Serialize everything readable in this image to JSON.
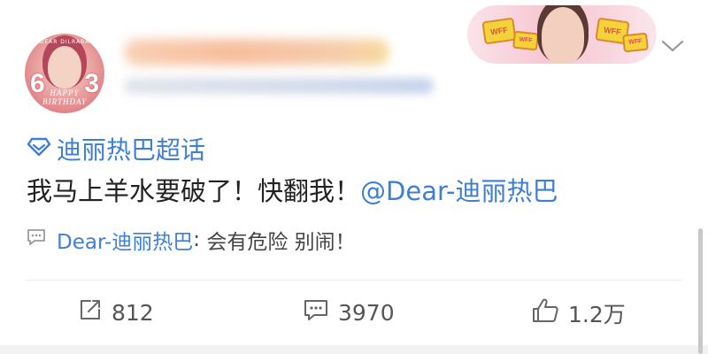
{
  "post": {
    "avatar": {
      "numbers": [
        "6",
        "3"
      ],
      "caption": "HAPPY BIRTHDAY",
      "top_text": "DEAR DILRABA"
    },
    "badge": {
      "sign_text": "WFF"
    },
    "topic": {
      "label": "迪丽热巴超话",
      "icon": "diamond-icon"
    },
    "body": {
      "text": "我马上羊水要破了！快翻我！",
      "mention": "@Dear-迪丽热巴"
    },
    "comment_preview": {
      "user": "Dear-迪丽热巴",
      "separator": ": ",
      "text": "会有危险 别闹！",
      "icon": "comment-bubble-icon"
    },
    "actions": {
      "repost_count": "812",
      "comment_count": "3970",
      "like_count": "1.2万"
    },
    "colors": {
      "link": "#3e7fd6",
      "text": "#222222",
      "muted": "#555555"
    }
  }
}
